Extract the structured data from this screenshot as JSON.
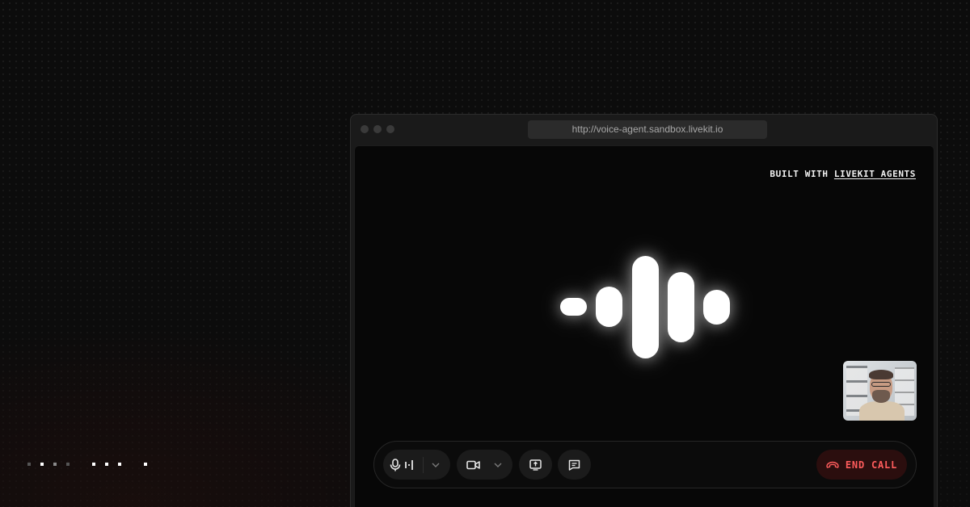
{
  "browser": {
    "url": "http://voice-agent.sandbox.livekit.io"
  },
  "app": {
    "built_with_prefix": "BUILT WITH",
    "built_with_link": "LIVEKIT AGENTS"
  },
  "controls": {
    "microphone_icon": "microphone-icon",
    "audio_level_icon": "audio-level-icon",
    "camera_icon": "video-camera-icon",
    "screenshare_icon": "screen-share-icon",
    "chat_icon": "chat-icon",
    "end_call_label": "END CALL",
    "end_call_color": "#ff5c5c"
  },
  "colors": {
    "background": "#0c0c0c",
    "accent_red": "#ff5c5c",
    "visualizer": "#ffffff"
  }
}
